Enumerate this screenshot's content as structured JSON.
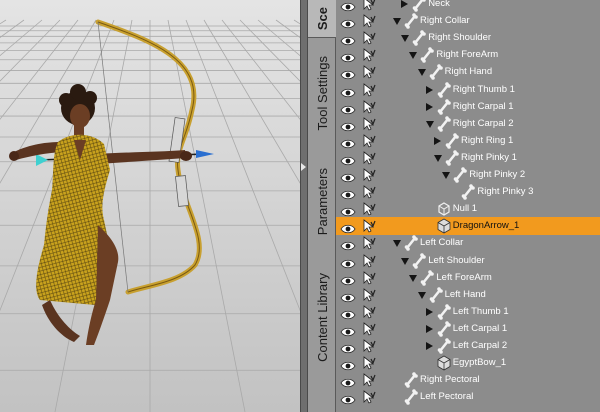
{
  "tabs": [
    {
      "label": "Sce",
      "active": true
    },
    {
      "label": "Tool Settings",
      "active": false
    },
    {
      "label": "Parameters",
      "active": false
    },
    {
      "label": "Content Library",
      "active": false
    }
  ],
  "colors": {
    "selection": "#f29a1e",
    "panel_bg": "#8c8c8c",
    "label_text": "#ffffff",
    "figure_outfit": "#c9a21d",
    "bow": "#c8a030"
  },
  "scene_tree": [
    {
      "label": "Neck",
      "icon": "bone-icon",
      "expander": "right",
      "selected": false
    },
    {
      "label": "Right Collar",
      "icon": "bone-icon",
      "expander": "down",
      "selected": false
    },
    {
      "label": "Right Shoulder",
      "icon": "bone-icon",
      "expander": "down",
      "selected": false
    },
    {
      "label": "Right ForeArm",
      "icon": "bone-icon",
      "expander": "down",
      "selected": false
    },
    {
      "label": "Right Hand",
      "icon": "bone-icon",
      "expander": "down",
      "selected": false
    },
    {
      "label": "Right Thumb 1",
      "icon": "bone-icon",
      "expander": "right",
      "selected": false
    },
    {
      "label": "Right Carpal 1",
      "icon": "bone-icon",
      "expander": "right",
      "selected": false
    },
    {
      "label": "Right Carpal 2",
      "icon": "bone-icon",
      "expander": "down",
      "selected": false
    },
    {
      "label": "Right Ring 1",
      "icon": "bone-icon",
      "expander": "right",
      "selected": false
    },
    {
      "label": "Right Pinky 1",
      "icon": "bone-icon",
      "expander": "down",
      "selected": false
    },
    {
      "label": "Right Pinky 2",
      "icon": "bone-icon",
      "expander": "down",
      "selected": false
    },
    {
      "label": "Right Pinky 3",
      "icon": "bone-icon",
      "expander": "none",
      "selected": false
    },
    {
      "label": "Null 1",
      "icon": "null-icon",
      "expander": "none",
      "selected": false
    },
    {
      "label": "DragonArrow_1",
      "icon": "prop-icon",
      "expander": "none",
      "selected": true
    },
    {
      "label": "Left Collar",
      "icon": "bone-icon",
      "expander": "down",
      "selected": false
    },
    {
      "label": "Left Shoulder",
      "icon": "bone-icon",
      "expander": "down",
      "selected": false
    },
    {
      "label": "Left ForeArm",
      "icon": "bone-icon",
      "expander": "down",
      "selected": false
    },
    {
      "label": "Left Hand",
      "icon": "bone-icon",
      "expander": "down",
      "selected": false
    },
    {
      "label": "Left Thumb 1",
      "icon": "bone-icon",
      "expander": "right",
      "selected": false
    },
    {
      "label": "Left Carpal 1",
      "icon": "bone-icon",
      "expander": "right",
      "selected": false
    },
    {
      "label": "Left Carpal 2",
      "icon": "bone-icon",
      "expander": "right",
      "selected": false
    },
    {
      "label": "EgyptBow_1",
      "icon": "prop-icon",
      "expander": "none",
      "selected": false
    },
    {
      "label": "Right Pectoral",
      "icon": "bone-icon",
      "expander": "none",
      "selected": false
    },
    {
      "label": "Left Pectoral",
      "icon": "bone-icon",
      "expander": "none",
      "selected": false
    }
  ]
}
